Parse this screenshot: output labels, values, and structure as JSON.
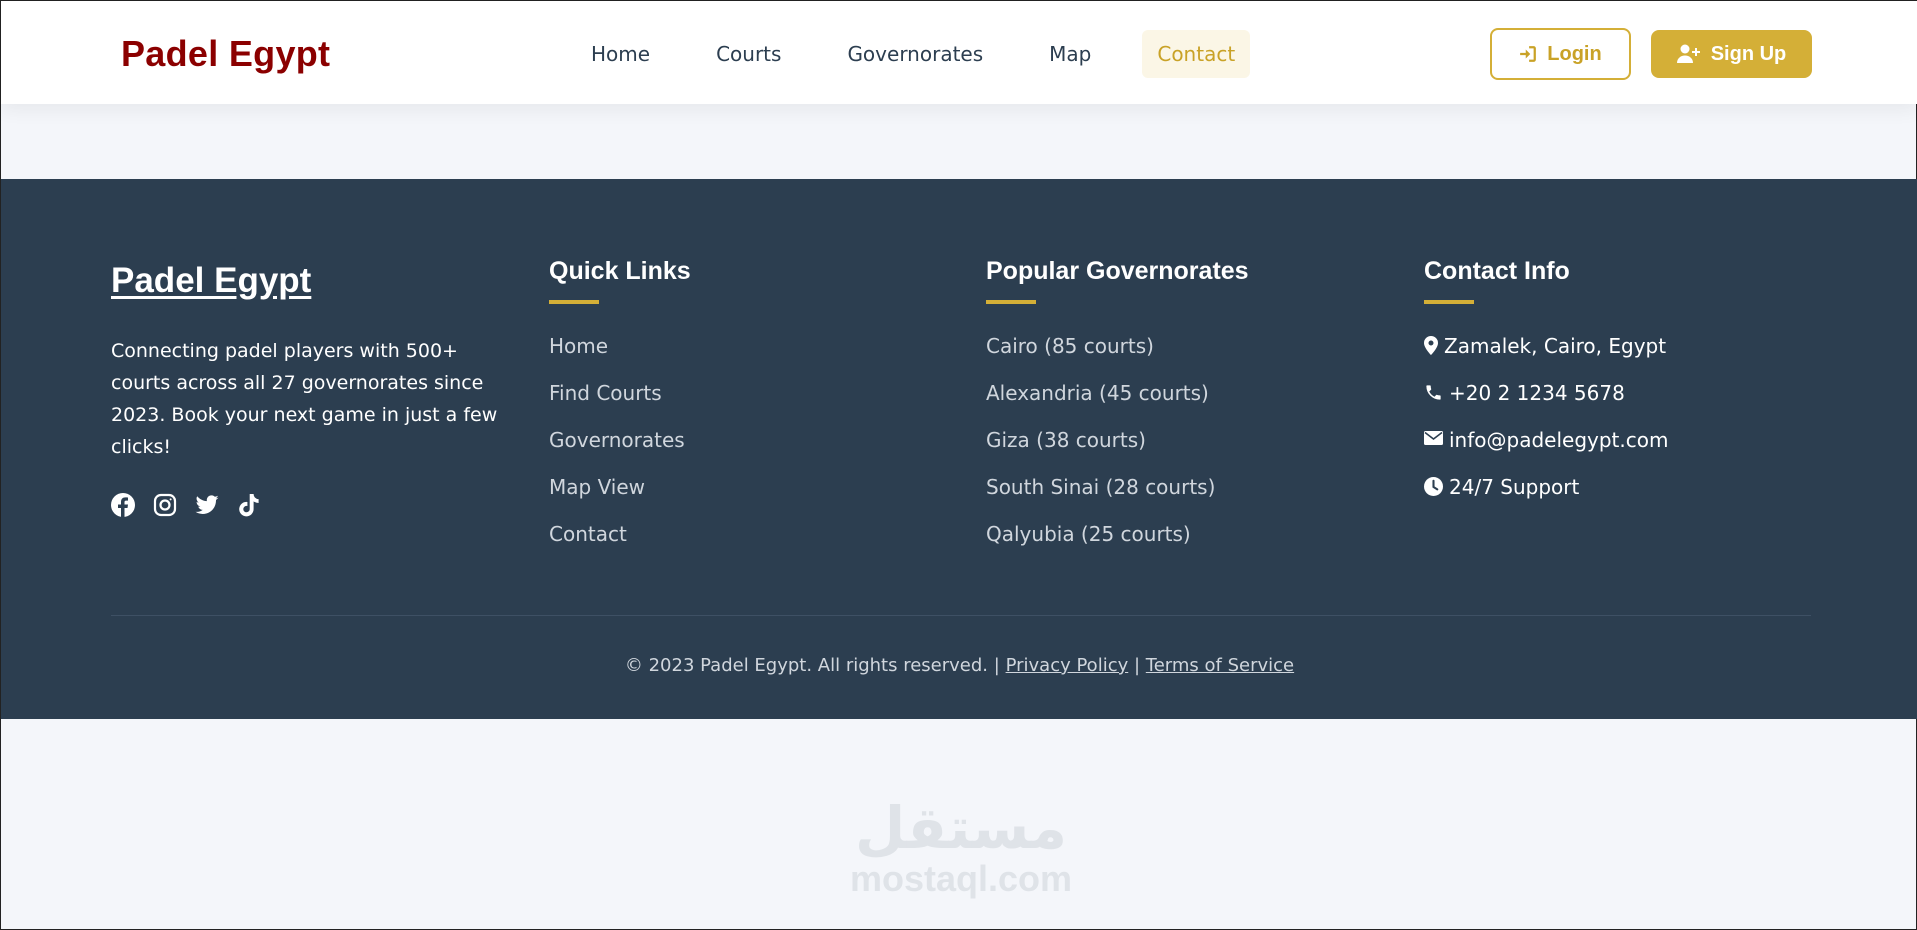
{
  "navbar": {
    "brand": "Padel Egypt",
    "links": [
      {
        "label": "Home",
        "active": false
      },
      {
        "label": "Courts",
        "active": false
      },
      {
        "label": "Governorates",
        "active": false
      },
      {
        "label": "Map",
        "active": false
      },
      {
        "label": "Contact",
        "active": true
      }
    ],
    "login_label": "Login",
    "signup_label": "Sign Up",
    "login_icon": "sign-in-icon",
    "signup_icon": "user-plus-icon"
  },
  "footer": {
    "brand": "Padel Egypt",
    "about": "Connecting padel players with 500+ courts across all 27 governorates since 2023. Book your next game in just a few clicks!",
    "social": [
      "facebook-icon",
      "instagram-icon",
      "twitter-icon",
      "tiktok-icon"
    ],
    "quick_links": {
      "title": "Quick Links",
      "items": [
        "Home",
        "Find Courts",
        "Governorates",
        "Map View",
        "Contact"
      ]
    },
    "governorates": {
      "title": "Popular Governorates",
      "items": [
        "Cairo (85 courts)",
        "Alexandria (45 courts)",
        "Giza (38 courts)",
        "South Sinai (28 courts)",
        "Qalyubia (25 courts)"
      ]
    },
    "contact": {
      "title": "Contact Info",
      "items": [
        {
          "icon": "map-marker-icon",
          "text": "Zamalek, Cairo, Egypt"
        },
        {
          "icon": "phone-icon",
          "text": "+20 2 1234 5678"
        },
        {
          "icon": "envelope-icon",
          "text": "info@padelegypt.com"
        },
        {
          "icon": "clock-icon",
          "text": "24/7 Support"
        }
      ]
    },
    "copyright": "© 2023 Padel Egypt. All rights reserved.",
    "separator": "|",
    "privacy_label": "Privacy Policy",
    "terms_label": "Terms of Service"
  },
  "watermark": {
    "arabic": "مستقل",
    "latin": "mostaql.com"
  },
  "colors": {
    "brand_red": "#8b0000",
    "accent_gold": "#d4af37",
    "footer_bg": "#2c3e50",
    "page_bg": "#f4f6fa"
  }
}
